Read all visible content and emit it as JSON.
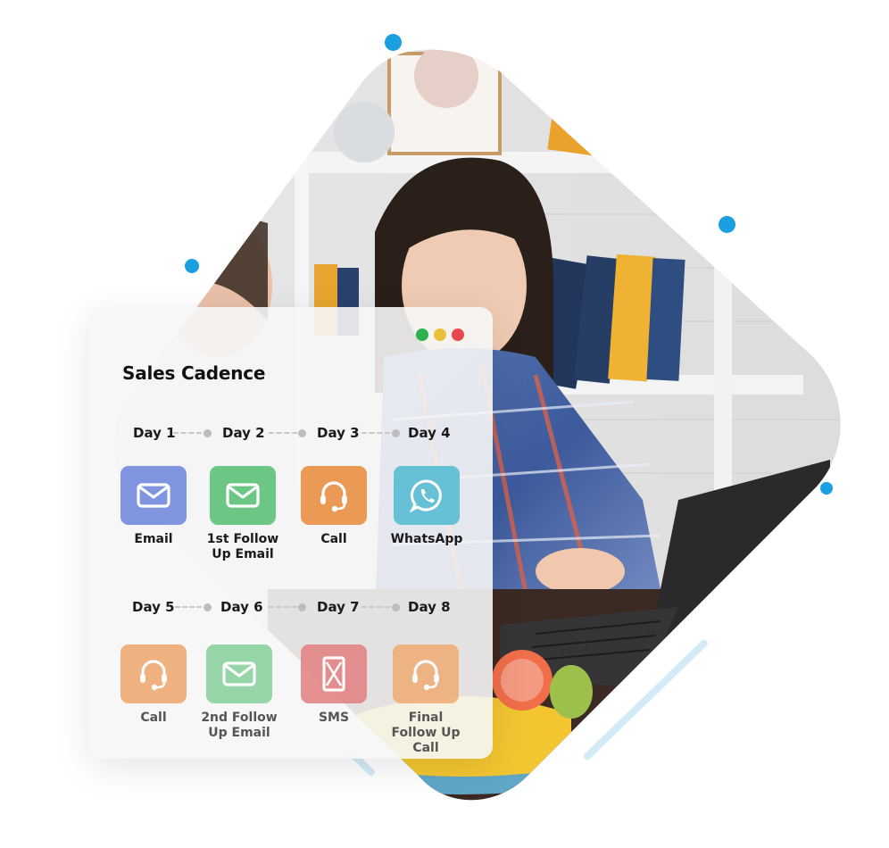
{
  "card": {
    "title": "Sales Cadence",
    "window_dots": [
      {
        "name": "green",
        "color": "#2bb24c"
      },
      {
        "name": "yellow",
        "color": "#e8c23a"
      },
      {
        "name": "red",
        "color": "#e8474c"
      }
    ],
    "rows": [
      {
        "days": [
          "Day 1",
          "Day 2",
          "Day 3",
          "Day 4"
        ],
        "steps": [
          {
            "label": "Email",
            "icon": "envelope-icon",
            "color": "#7f95e0"
          },
          {
            "label": "1st Follow Up Email",
            "icon": "envelope-icon",
            "color": "#6cc784"
          },
          {
            "label": "Call",
            "icon": "headset-icon",
            "color": "#eb9a55"
          },
          {
            "label": "WhatsApp",
            "icon": "whatsapp-icon",
            "color": "#67c1d6"
          }
        ]
      },
      {
        "days": [
          "Day 5",
          "Day 6",
          "Day 7",
          "Day 8"
        ],
        "steps": [
          {
            "label": "Call",
            "icon": "headset-icon",
            "color": "#eda56b"
          },
          {
            "label": "2nd Follow Up Email",
            "icon": "envelope-icon",
            "color": "#86d09a"
          },
          {
            "label": "SMS",
            "icon": "sms-phone-icon",
            "color": "#e27f80"
          },
          {
            "label": "Final Follow Up Call",
            "icon": "headset-icon",
            "color": "#efab72"
          }
        ]
      }
    ]
  },
  "decor": {
    "accent": "#1a9fe0",
    "line_color": "#d3ebf7"
  }
}
